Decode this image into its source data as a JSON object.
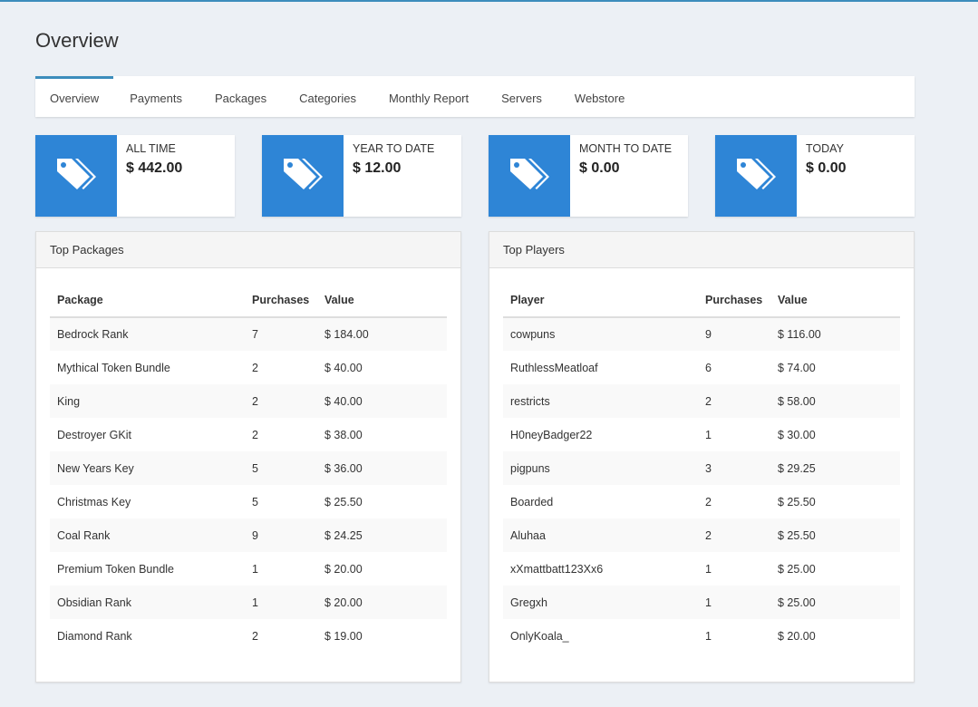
{
  "page": {
    "title": "Overview"
  },
  "tabs": [
    {
      "label": "Overview",
      "active": true
    },
    {
      "label": "Payments"
    },
    {
      "label": "Packages"
    },
    {
      "label": "Categories"
    },
    {
      "label": "Monthly Report"
    },
    {
      "label": "Servers"
    },
    {
      "label": "Webstore"
    }
  ],
  "stats": [
    {
      "label": "ALL TIME",
      "value": "$ 442.00",
      "icon": "tags-icon"
    },
    {
      "label": "YEAR TO DATE",
      "value": "$ 12.00",
      "icon": "tags-icon"
    },
    {
      "label": "MONTH TO DATE",
      "value": "$ 0.00",
      "icon": "tags-icon"
    },
    {
      "label": "TODAY",
      "value": "$ 0.00",
      "icon": "tags-icon"
    }
  ],
  "colors": {
    "accent": "#2e85d6",
    "tab_active_border": "#3c8dbc",
    "background": "#ecf0f5"
  },
  "top_packages": {
    "title": "Top Packages",
    "columns": [
      "Package",
      "Purchases",
      "Value"
    ],
    "rows": [
      [
        "Bedrock Rank",
        "7",
        "$ 184.00"
      ],
      [
        "Mythical Token Bundle",
        "2",
        "$ 40.00"
      ],
      [
        "King",
        "2",
        "$ 40.00"
      ],
      [
        "Destroyer GKit",
        "2",
        "$ 38.00"
      ],
      [
        "New Years Key",
        "5",
        "$ 36.00"
      ],
      [
        "Christmas Key",
        "5",
        "$ 25.50"
      ],
      [
        "Coal Rank",
        "9",
        "$ 24.25"
      ],
      [
        "Premium Token Bundle",
        "1",
        "$ 20.00"
      ],
      [
        "Obsidian Rank",
        "1",
        "$ 20.00"
      ],
      [
        "Diamond Rank",
        "2",
        "$ 19.00"
      ]
    ]
  },
  "top_players": {
    "title": "Top Players",
    "columns": [
      "Player",
      "Purchases",
      "Value"
    ],
    "rows": [
      [
        "cowpuns",
        "9",
        "$ 116.00"
      ],
      [
        "RuthlessMeatloaf",
        "6",
        "$ 74.00"
      ],
      [
        "restricts",
        "2",
        "$ 58.00"
      ],
      [
        "H0neyBadger22",
        "1",
        "$ 30.00"
      ],
      [
        "pigpuns",
        "3",
        "$ 29.25"
      ],
      [
        "Boarded",
        "2",
        "$ 25.50"
      ],
      [
        "Aluhaa",
        "2",
        "$ 25.50"
      ],
      [
        "xXmattbatt123Xx6",
        "1",
        "$ 25.00"
      ],
      [
        "Gregxh",
        "1",
        "$ 25.00"
      ],
      [
        "OnlyKoala_",
        "1",
        "$ 20.00"
      ]
    ]
  }
}
